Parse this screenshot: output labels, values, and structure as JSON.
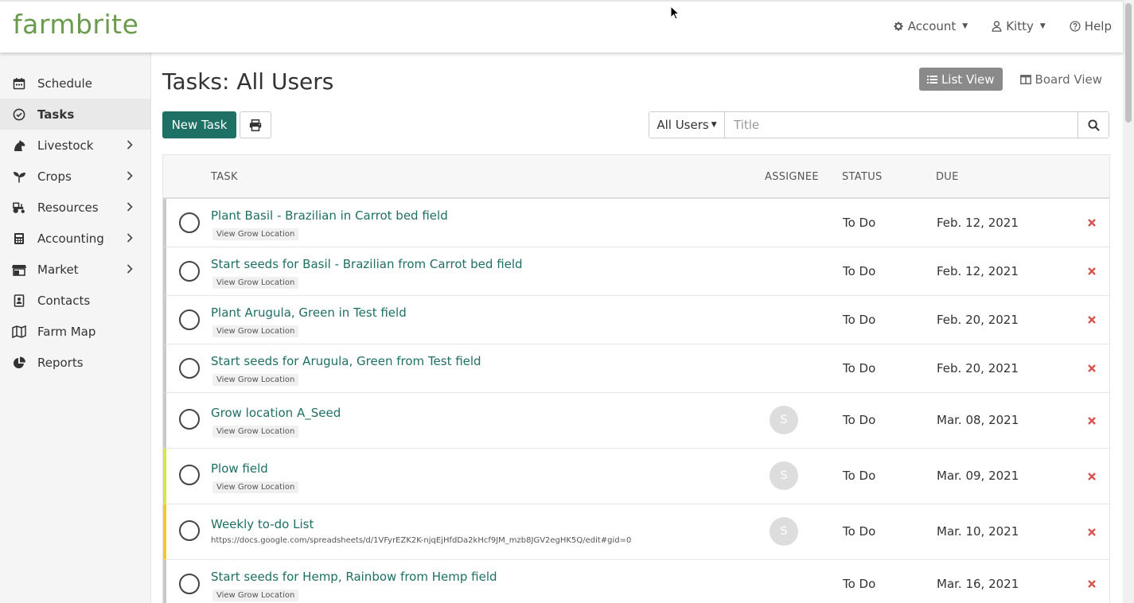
{
  "header": {
    "logo_text": "farmbrite",
    "nav": [
      {
        "label": "Account",
        "icon": "gear-icon"
      },
      {
        "label": "Kitty",
        "icon": "user-icon"
      },
      {
        "label": "Help",
        "icon": "question-circle-icon"
      }
    ]
  },
  "sidebar": {
    "items": [
      {
        "label": "Schedule",
        "icon": "calendar-icon",
        "has_children": false
      },
      {
        "label": "Tasks",
        "icon": "check-circle-icon",
        "has_children": false,
        "active": true
      },
      {
        "label": "Livestock",
        "icon": "horse-icon",
        "has_children": true
      },
      {
        "label": "Crops",
        "icon": "seedling-icon",
        "has_children": true
      },
      {
        "label": "Resources",
        "icon": "tractor-icon",
        "has_children": true
      },
      {
        "label": "Accounting",
        "icon": "calculator-icon",
        "has_children": true
      },
      {
        "label": "Market",
        "icon": "store-icon",
        "has_children": true
      },
      {
        "label": "Contacts",
        "icon": "address-book-icon",
        "has_children": false
      },
      {
        "label": "Farm Map",
        "icon": "map-icon",
        "has_children": false
      },
      {
        "label": "Reports",
        "icon": "pie-chart-icon",
        "has_children": false
      }
    ]
  },
  "main": {
    "title": "Tasks: All Users",
    "list_view_label": "List View",
    "board_view_label": "Board View",
    "new_task_label": "New Task",
    "user_filter": "All Users",
    "title_placeholder": "Title",
    "columns": {
      "task": "TASK",
      "assignee": "ASSIGNEE",
      "status": "STATUS",
      "due": "DUE"
    },
    "tasks": [
      {
        "name": "Plant Basil - Brazilian in Carrot bed field",
        "tag": "View Grow Location",
        "assignee": "",
        "status": "To Do",
        "due": "Feb. 12, 2021",
        "color": "#c9c9c9"
      },
      {
        "name": "Start seeds for Basil - Brazilian from Carrot bed field",
        "tag": "View Grow Location",
        "assignee": "",
        "status": "To Do",
        "due": "Feb. 12, 2021",
        "color": "#c9c9c9"
      },
      {
        "name": "Plant Arugula, Green in Test field",
        "tag": "View Grow Location",
        "assignee": "",
        "status": "To Do",
        "due": "Feb. 20, 2021",
        "color": "#c9c9c9"
      },
      {
        "name": "Start seeds for Arugula, Green from Test field",
        "tag": "View Grow Location",
        "assignee": "",
        "status": "To Do",
        "due": "Feb. 20, 2021",
        "color": "#c9c9c9"
      },
      {
        "name": "Grow location A_Seed",
        "tag": "View Grow Location",
        "assignee": "S",
        "status": "To Do",
        "due": "Mar. 08, 2021",
        "color": "#c9c9c9"
      },
      {
        "name": "Plow field",
        "tag": "View Grow Location",
        "assignee": "S",
        "status": "To Do",
        "due": "Mar. 09, 2021",
        "color": "#d6e34a"
      },
      {
        "name": "Weekly to-do List",
        "link": "https://docs.google.com/spreadsheets/d/1VFyrEZK2K-njqEjHfdDa2kHcf9JM_mzb8JGV2egHK5Q/edit#gid=0",
        "assignee": "S",
        "status": "To Do",
        "due": "Mar. 10, 2021",
        "color": "#f0c930"
      },
      {
        "name": "Start seeds for Hemp, Rainbow from Hemp field",
        "tag": "View Grow Location",
        "assignee": "",
        "status": "To Do",
        "due": "Mar. 16, 2021",
        "color": "#c9c9c9"
      }
    ]
  }
}
